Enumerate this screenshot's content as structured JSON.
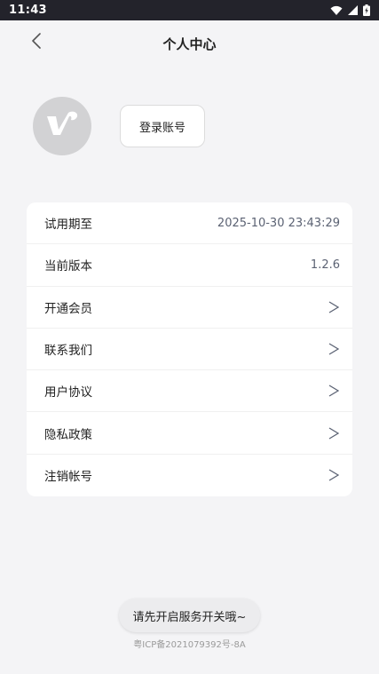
{
  "status_bar": {
    "time": "11:43",
    "icons": [
      "wifi-icon",
      "signal-icon",
      "battery-charging-icon"
    ]
  },
  "header": {
    "back_icon": "chevron-left-icon",
    "title": "个人中心"
  },
  "profile": {
    "avatar_icon": "v-logo-icon",
    "login_button": "登录账号"
  },
  "menu": {
    "rows": [
      {
        "label": "试用期至",
        "value": "2025-10-30 23:43:29"
      },
      {
        "label": "当前版本",
        "value": "1.2.6"
      },
      {
        "label": "开通会员",
        "arrow": ">"
      },
      {
        "label": "联系我们",
        "arrow": ">"
      },
      {
        "label": "用户协议",
        "arrow": ">"
      },
      {
        "label": "隐私政策",
        "arrow": ">"
      },
      {
        "label": "注销帐号",
        "arrow": ">"
      }
    ]
  },
  "toast": {
    "text": "请先开启服务开关哦~"
  },
  "footer": {
    "icp": "粤ICP备2021079392号-8A"
  },
  "colors": {
    "status_bar_bg": "#23232b",
    "page_bg": "#f4f4f6",
    "value_text": "#5b6273",
    "avatar_bg": "#d2d2d4"
  }
}
